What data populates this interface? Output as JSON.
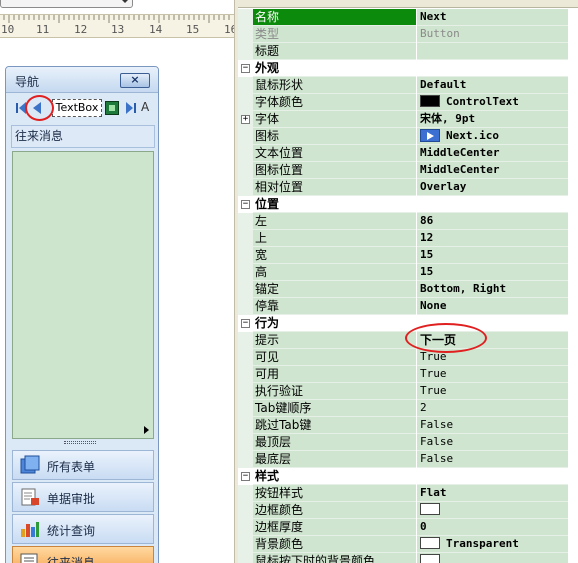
{
  "ruler": {
    "numbers": [
      "10",
      "11",
      "12",
      "13",
      "14",
      "15",
      "16"
    ]
  },
  "nav_panel": {
    "title": "导航",
    "close_label": "×",
    "toolbar": {
      "textbox_label": "TextBox",
      "a_label": "A"
    },
    "section_label": "往来消息",
    "items": [
      {
        "label": "所有表单",
        "icon": "forms-icon"
      },
      {
        "label": "单据审批",
        "icon": "approval-icon"
      },
      {
        "label": "统计查询",
        "icon": "chart-icon"
      },
      {
        "label": "往来消息",
        "icon": "message-icon"
      }
    ]
  },
  "property_grid": {
    "rows": [
      {
        "name": "名称",
        "value": "Next",
        "kind": "selected"
      },
      {
        "name": "类型",
        "value": "Button",
        "kind": "readonly"
      },
      {
        "name": "标题",
        "value": "",
        "kind": "normal"
      },
      {
        "name": "外观",
        "value": "",
        "kind": "category",
        "expander": "−"
      },
      {
        "name": "鼠标形状",
        "value": "Default",
        "kind": "normal"
      },
      {
        "name": "字体颜色",
        "value": "ControlText",
        "kind": "color",
        "swatch": "#000000"
      },
      {
        "name": "字体",
        "value": "宋体, 9pt",
        "kind": "normal",
        "expander": "+"
      },
      {
        "name": "图标",
        "value": "Next.ico",
        "kind": "icon"
      },
      {
        "name": "文本位置",
        "value": "MiddleCenter",
        "kind": "normal"
      },
      {
        "name": "图标位置",
        "value": "MiddleCenter",
        "kind": "normal"
      },
      {
        "name": "相对位置",
        "value": "Overlay",
        "kind": "normal"
      },
      {
        "name": "位置",
        "value": "",
        "kind": "category",
        "expander": "−"
      },
      {
        "name": "左",
        "value": "86",
        "kind": "normal"
      },
      {
        "name": "上",
        "value": "12",
        "kind": "normal"
      },
      {
        "name": "宽",
        "value": "15",
        "kind": "normal"
      },
      {
        "name": "高",
        "value": "15",
        "kind": "normal"
      },
      {
        "name": "锚定",
        "value": "Bottom, Right",
        "kind": "normal"
      },
      {
        "name": "停靠",
        "value": "None",
        "kind": "normal"
      },
      {
        "name": "行为",
        "value": "",
        "kind": "category",
        "expander": "−"
      },
      {
        "name": "提示",
        "value": "下一页",
        "kind": "tip"
      },
      {
        "name": "可见",
        "value": "True",
        "kind": "plain"
      },
      {
        "name": "可用",
        "value": "True",
        "kind": "plain"
      },
      {
        "name": "执行验证",
        "value": "True",
        "kind": "plain"
      },
      {
        "name": "Tab键顺序",
        "value": "2",
        "kind": "plain"
      },
      {
        "name": "跳过Tab键",
        "value": "False",
        "kind": "plain"
      },
      {
        "name": "最顶层",
        "value": "False",
        "kind": "plain"
      },
      {
        "name": "最底层",
        "value": "False",
        "kind": "plain"
      },
      {
        "name": "样式",
        "value": "",
        "kind": "category",
        "expander": "−"
      },
      {
        "name": "按钮样式",
        "value": "Flat",
        "kind": "normal"
      },
      {
        "name": "边框颜色",
        "value": "",
        "kind": "color",
        "swatch": "#ffffff"
      },
      {
        "name": "边框厚度",
        "value": "0",
        "kind": "normal"
      },
      {
        "name": "背景颜色",
        "value": "Transparent",
        "kind": "color",
        "swatch": "#ffffff"
      },
      {
        "name": "鼠标按下时的背景颜色",
        "value": "",
        "kind": "color",
        "swatch": "#ffffff"
      }
    ]
  },
  "colors": {
    "selected_row": "#0b8a0b",
    "grid_row": "#cfe5cf",
    "annotation_circle": "#e02020"
  }
}
